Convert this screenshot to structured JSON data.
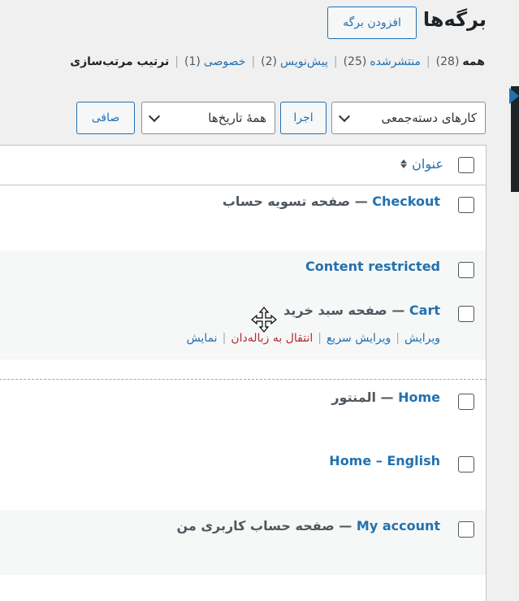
{
  "header": {
    "title": "برگه‌ها",
    "add_new": "افزودن برگه"
  },
  "views": [
    {
      "label": "همه",
      "count": "(28)",
      "current": true
    },
    {
      "label": "منتشرشده",
      "count": "(25)"
    },
    {
      "label": "پیش‌نویس",
      "count": "(2)"
    },
    {
      "label": "خصوصی",
      "count": "(1)"
    },
    {
      "label": "ترتیب مرتب‌سازی",
      "count": "",
      "current": true
    }
  ],
  "filters": {
    "bulk_actions": "کارهای دسته‌جمعی",
    "apply": "اجرا",
    "all_dates": "همهٔ تاریخ‌ها",
    "filter": "صافی"
  },
  "table": {
    "col_title": "عنوان",
    "rows": [
      {
        "title": "Checkout",
        "state": "صفحه تسویه حساب"
      },
      {
        "title": "Content restricted",
        "state": ""
      },
      {
        "title": "Cart",
        "state": "صفحه سبد خرید"
      },
      {
        "title": "Home",
        "state": "المنتور"
      },
      {
        "title": "Home – English",
        "state": ""
      },
      {
        "title": "My account",
        "state": "صفحه حساب کاربری من"
      }
    ],
    "row_actions": {
      "edit": "ویرایش",
      "quick_edit": "ویرایش سریع",
      "trash": "انتقال به زباله‌دان",
      "view": "نمایش"
    }
  }
}
